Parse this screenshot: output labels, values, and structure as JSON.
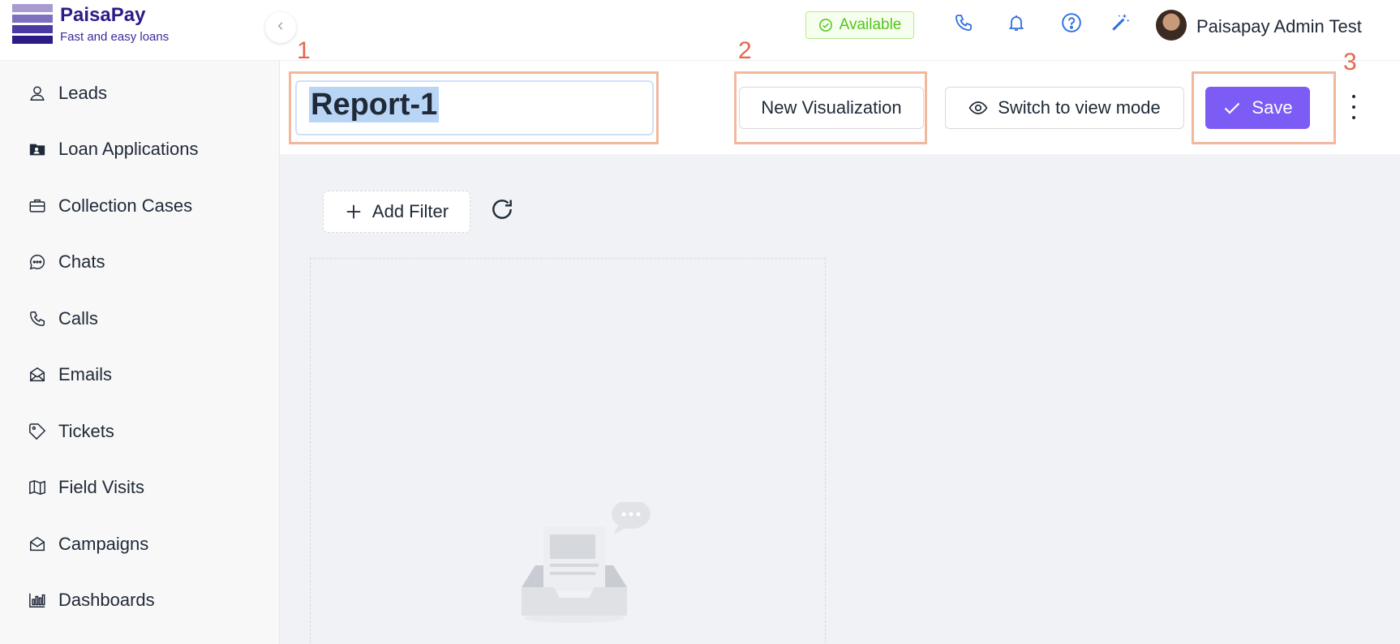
{
  "brand": {
    "name": "PaisaPay",
    "tagline": "Fast and easy loans",
    "logo_colors": [
      "#a79bd0",
      "#7f6fbf",
      "#4b3aa3",
      "#2e1a87"
    ]
  },
  "sidebar": {
    "items": [
      {
        "label": "Leads",
        "icon": "user-icon"
      },
      {
        "label": "Loan Applications",
        "icon": "contact-card-icon"
      },
      {
        "label": "Collection Cases",
        "icon": "briefcase-icon"
      },
      {
        "label": "Chats",
        "icon": "chat-bubble-icon"
      },
      {
        "label": "Calls",
        "icon": "phone-icon"
      },
      {
        "label": "Emails",
        "icon": "envelope-icon"
      },
      {
        "label": "Tickets",
        "icon": "ticket-icon"
      },
      {
        "label": "Field Visits",
        "icon": "map-icon"
      },
      {
        "label": "Campaigns",
        "icon": "envelope-open-icon"
      },
      {
        "label": "Dashboards",
        "icon": "bar-chart-icon"
      }
    ]
  },
  "header": {
    "status": "Available",
    "user_name": "Paisapay Admin Test",
    "icons": [
      "phone-icon",
      "bell-icon",
      "help-icon",
      "magic-wand-icon"
    ]
  },
  "toolbar": {
    "report_title": "Report-1",
    "new_visualization_label": "New Visualization",
    "view_mode_label": "Switch to view mode",
    "save_label": "Save"
  },
  "annotations": [
    "1",
    "2",
    "3"
  ],
  "content": {
    "add_filter_label": "Add Filter"
  },
  "colors": {
    "primary": "#7c5cf5",
    "status_green": "#52c41a",
    "annotation": "#e6674d",
    "icon_blue": "#2f6fe0"
  }
}
